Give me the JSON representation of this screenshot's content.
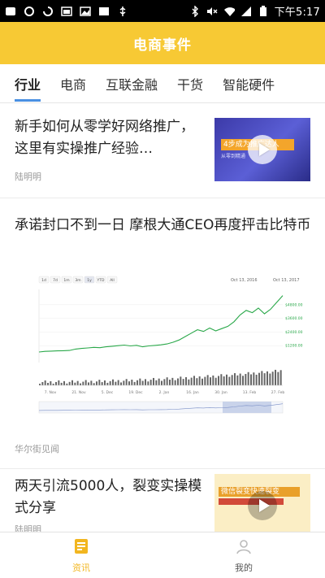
{
  "status_bar": {
    "time": "下午5:17",
    "icons": [
      "wechat-icon",
      "circle-icon",
      "loading-icon",
      "gallery-icon",
      "image-icon",
      "image-icon",
      "usb-icon",
      "bluetooth-icon",
      "mute-icon",
      "wifi-icon",
      "signal-icon",
      "battery-icon"
    ]
  },
  "header": {
    "title": "电商事件"
  },
  "tabs": [
    {
      "label": "行业",
      "active": true
    },
    {
      "label": "电商",
      "active": false
    },
    {
      "label": "互联金融",
      "active": false
    },
    {
      "label": "干货",
      "active": false
    },
    {
      "label": "智能硬件",
      "active": false
    }
  ],
  "articles": [
    {
      "title": "新手如何从零学好网络推广，这里有实操推广经验…",
      "source": "陆明明",
      "thumb_band": "4步成为推广达人",
      "thumb_sub": "从零到精通"
    },
    {
      "title": "承诺封口不到一日 摩根大通CEO再度抨击比特币",
      "source": "华尔街见闻"
    },
    {
      "title": "两天引流5000人，裂变实操模式分享",
      "source": "陆明明",
      "thumb_band": "微信裂变快速裂变"
    }
  ],
  "chart_data": {
    "type": "line",
    "title": "",
    "range_buttons": [
      "1d",
      "7d",
      "1m",
      "3m",
      "1y",
      "YTD",
      "All"
    ],
    "selected_range": "1y",
    "date_from": "Oct 13, 2016",
    "date_to": "Oct 13, 2017",
    "x_ticks": [
      "7. Nov",
      "21. Nov",
      "5. Dec",
      "19. Dec",
      "2. Jan",
      "16. Jan",
      "30. Jan",
      "13. Feb",
      "27. Feb"
    ],
    "y_ticks": [
      "$4800.00",
      "$3600.00",
      "$2400.00",
      "$1200.00"
    ],
    "series": [
      {
        "values": [
          640,
          700,
          720,
          740,
          760,
          780,
          900,
          960,
          1000,
          1050,
          1020,
          1100,
          1150,
          1200,
          1250,
          1180,
          1230,
          1100,
          1180,
          1220,
          1270,
          1350,
          1500,
          1700,
          2000,
          2300,
          2600,
          2450,
          2750,
          2500,
          2700,
          2900,
          3300,
          3900,
          4300,
          4100,
          4500,
          4000,
          4400,
          5000,
          5600
        ]
      }
    ]
  },
  "bottom_nav": [
    {
      "label": "资讯",
      "icon": "news-icon",
      "active": true
    },
    {
      "label": "我的",
      "icon": "profile-icon",
      "active": false
    }
  ],
  "colors": {
    "brand_yellow": "#f7c934",
    "tab_underline": "#4a90e2",
    "chart_line": "#2aa84a",
    "nav_active": "#f2b620"
  }
}
